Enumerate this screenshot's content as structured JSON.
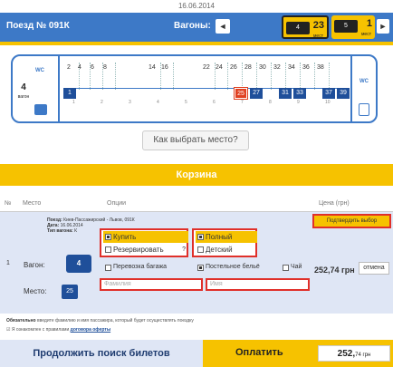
{
  "header": {
    "date": "16.06.2014",
    "train": "Поезд № 091К",
    "wagons_label": "Вагоны:",
    "prev_arrow": "◄",
    "next_arrow": "►",
    "wagons": [
      {
        "car": "4",
        "free": "23",
        "free_label": "мест",
        "selected": true
      },
      {
        "car": "5",
        "free": "1",
        "free_label": "мест",
        "selected": false
      }
    ]
  },
  "plan": {
    "car_number": "4",
    "car_label": "вагон",
    "wc": "WC",
    "top_numbers": [
      "2",
      "4",
      "6",
      "8",
      "14",
      "16",
      "22",
      "24",
      "26",
      "28",
      "30",
      "32",
      "34",
      "36",
      "38"
    ],
    "bottom_seats": [
      "1",
      "25",
      "27",
      "31",
      "33",
      "37",
      "39"
    ],
    "selected_seat": "25",
    "compartments": [
      "1",
      "2",
      "3",
      "4",
      "5",
      "6",
      "7",
      "8",
      "9",
      "10"
    ]
  },
  "how_to_choose": "Как выбрать место?",
  "cart": {
    "title": "Корзина"
  },
  "table": {
    "headers": {
      "num": "№",
      "place": "Место",
      "options": "Опции",
      "price": "Цена (грн)"
    },
    "row": {
      "number": "1",
      "info": {
        "train_label": "Поезд:",
        "train_value": "Киев-Пассажирский - Львов, 091К",
        "date_label": "Дата:",
        "date_value": "16.06.2014",
        "type_label": "Тип вагона:",
        "type_value": "К"
      },
      "wagon_label": "Вагон:",
      "wagon_value": "4",
      "seat_label": "Место:",
      "seat_value": "25",
      "buy": "Купить",
      "reserve": "Резервировать",
      "full": "Полный",
      "child": "Детский",
      "help": "?",
      "baggage": "Перевозка багажа",
      "linen": "Постельное бельё",
      "tea": "Чай",
      "surname_placeholder": "Фамилия",
      "name_placeholder": "Имя",
      "confirm": "Подтвердить выбор",
      "price": "252,74 грн",
      "cancel": "отмена"
    }
  },
  "notes": {
    "required_bold": "Обязательно",
    "required_text": "введите фамилию и имя пассажира, который будет осуществлять поездку",
    "agree_text": "Я ознакомлен с правилами",
    "agree_link": "договора оферты"
  },
  "footer": {
    "continue": "Продолжить поиск билетов",
    "pay": "Оплатить",
    "total_main": "252,",
    "total_small": "74 грн"
  },
  "colors": {
    "brand_blue": "#3d79c7",
    "accent_yellow": "#f6c200",
    "highlight_red": "#e0302a"
  }
}
